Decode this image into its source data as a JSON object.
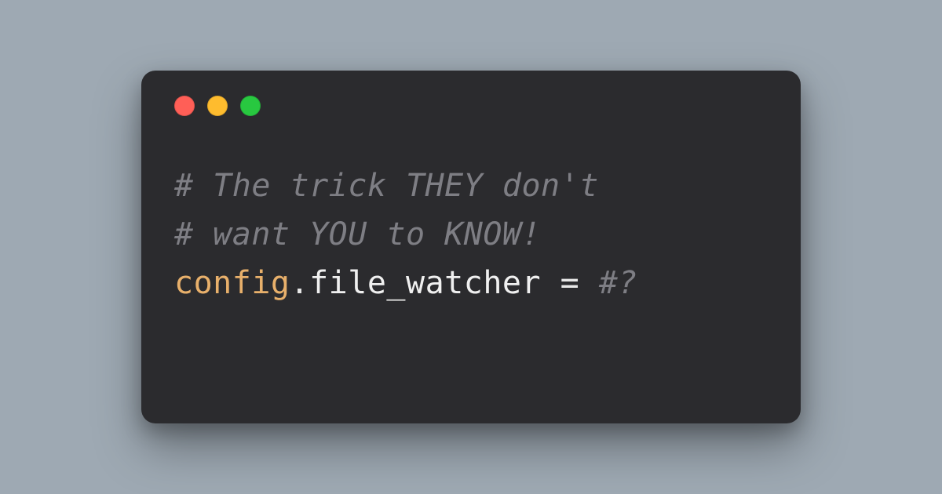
{
  "colors": {
    "background": "#9ea9b3",
    "window": "#2b2b2e",
    "traffic_red": "#ff5f57",
    "traffic_yellow": "#febc2e",
    "traffic_green": "#28c840",
    "comment": "#7e7e84",
    "identifier": "#e8b06b",
    "text": "#f0f0f0"
  },
  "code": {
    "line1": "# The trick THEY don't",
    "line2": "# want YOU to KNOW!",
    "line3": {
      "identifier": "config",
      "dot": ".",
      "member": "file_watcher",
      "space_eq": " = ",
      "trailing": "#?"
    }
  }
}
